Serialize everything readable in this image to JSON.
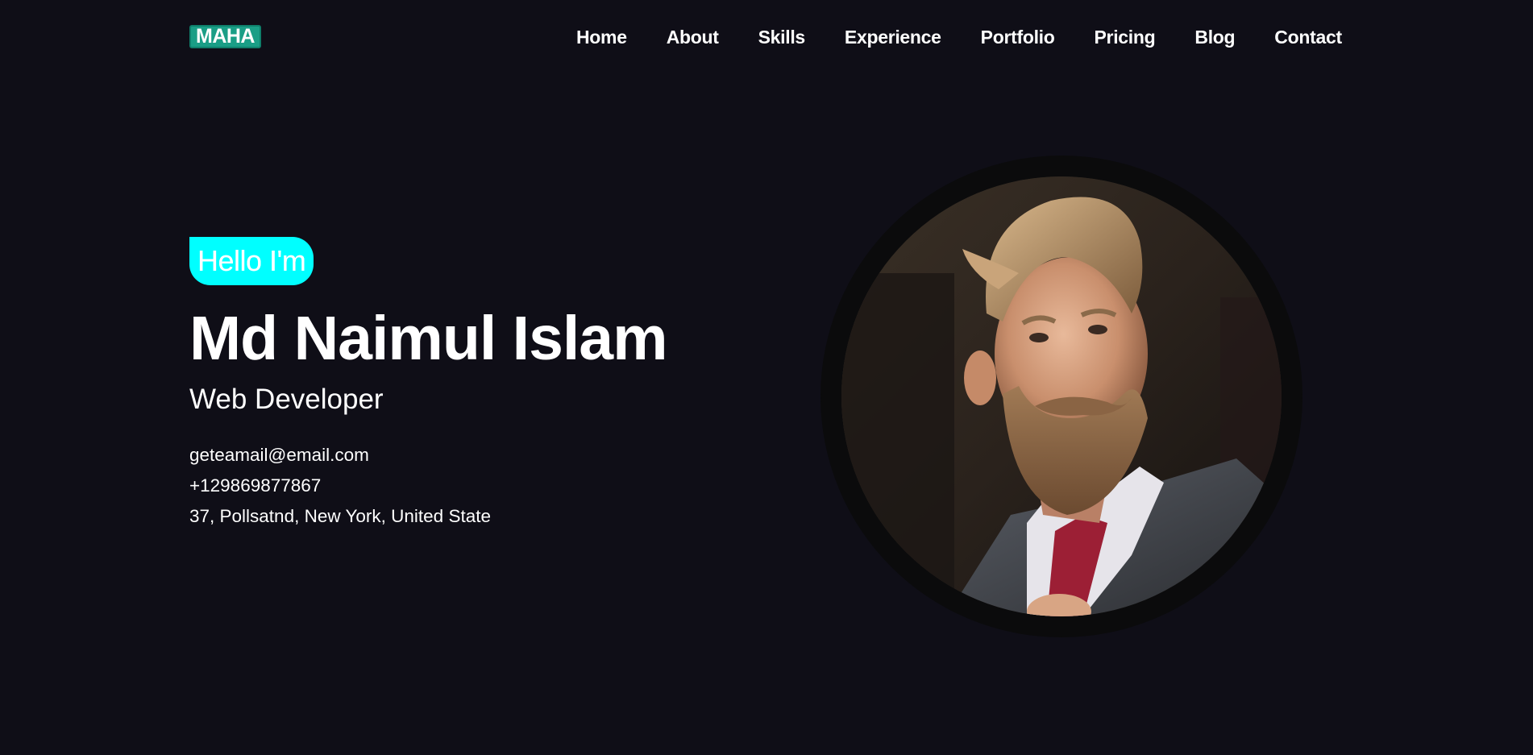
{
  "header": {
    "logo": "MAHA",
    "nav": [
      {
        "label": "Home"
      },
      {
        "label": "About"
      },
      {
        "label": "Skills"
      },
      {
        "label": "Experience"
      },
      {
        "label": "Portfolio"
      },
      {
        "label": "Pricing"
      },
      {
        "label": "Blog"
      },
      {
        "label": "Contact"
      }
    ]
  },
  "hero": {
    "greeting": "Hello I'm",
    "name": "Md Naimul Islam",
    "role": "Web Developer",
    "email": "geteamail@email.com",
    "phone": "+129869877867",
    "address": "37, Pollsatnd, New York, United State",
    "portrait_icon": "portrait-photo"
  },
  "colors": {
    "background": "#0f0e17",
    "logo_bg": "#1a9e86",
    "badge_bg": "#00ffff",
    "text": "#ffffff",
    "ring": "#0b0b0c"
  }
}
